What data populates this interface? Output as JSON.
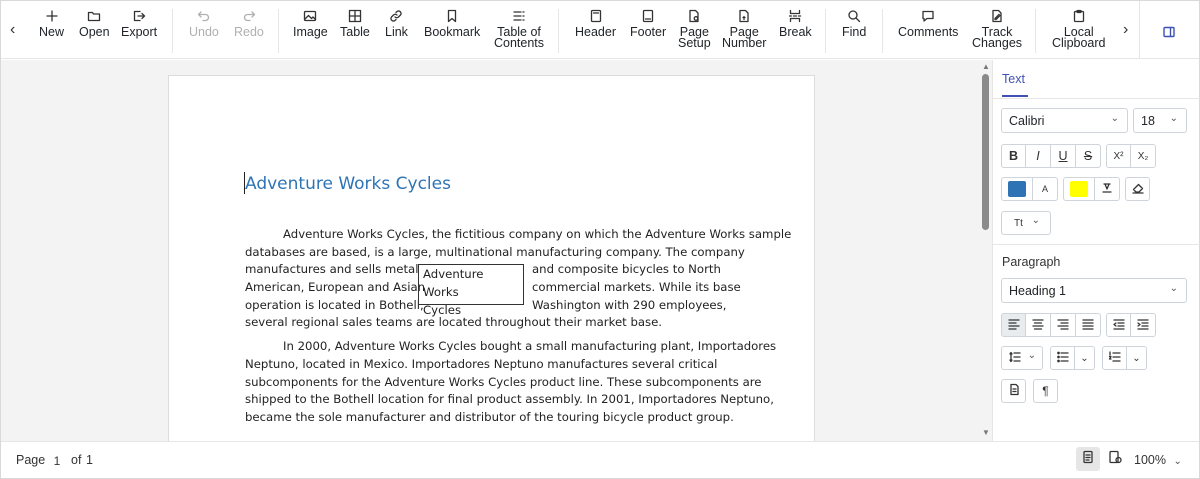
{
  "toolbar": {
    "nav_prev": "‹",
    "nav_next": "›",
    "items": [
      {
        "key": "new",
        "label": "New",
        "icon": "plus-icon"
      },
      {
        "key": "open",
        "label": "Open",
        "icon": "folder-icon"
      },
      {
        "key": "export",
        "label": "Export",
        "icon": "export-icon"
      },
      {
        "key": "undo",
        "label": "Undo",
        "icon": "undo-icon",
        "disabled": true
      },
      {
        "key": "redo",
        "label": "Redo",
        "icon": "redo-icon",
        "disabled": true
      },
      {
        "key": "image",
        "label": "Image",
        "icon": "image-icon"
      },
      {
        "key": "table",
        "label": "Table",
        "icon": "table-icon"
      },
      {
        "key": "link",
        "label": "Link",
        "icon": "link-icon"
      },
      {
        "key": "bookmark",
        "label": "Bookmark",
        "icon": "bookmark-icon"
      },
      {
        "key": "toc",
        "label": "Table of\nContents",
        "icon": "toc-icon"
      },
      {
        "key": "header",
        "label": "Header",
        "icon": "header-icon"
      },
      {
        "key": "footer",
        "label": "Footer",
        "icon": "footer-icon"
      },
      {
        "key": "page_setup",
        "label": "Page\nSetup",
        "icon": "page-setup-icon"
      },
      {
        "key": "page_number",
        "label": "Page\nNumber",
        "icon": "page-number-icon"
      },
      {
        "key": "break",
        "label": "Break",
        "icon": "break-icon"
      },
      {
        "key": "find",
        "label": "Find",
        "icon": "search-icon"
      },
      {
        "key": "comments",
        "label": "Comments",
        "icon": "comment-icon"
      },
      {
        "key": "track_changes",
        "label": "Track\nChanges",
        "icon": "track-changes-icon"
      },
      {
        "key": "local_clipboard",
        "label": "Local\nClipboard",
        "icon": "clipboard-icon"
      }
    ],
    "panel_toggle_icon": "panel-toggle-icon"
  },
  "document": {
    "title": "Adventure Works Cycles",
    "para1_lines": [
      "Adventure Works Cycles, the fictitious company on which the Adventure Works sample",
      "databases are based, is a large, multinational manufacturing company. The company"
    ],
    "wrap_left_lines": [
      "manufactures and sells metal",
      "American, European and Asian",
      "operation is located in Bothell,"
    ],
    "wrap_right_lines": [
      "and composite bicycles to North",
      "commercial markets. While its base",
      "Washington with 290 employees,"
    ],
    "para1_last_line": "several regional sales teams are located throughout their market base.",
    "textbox_lines": [
      "Adventure Works",
      "Cycles"
    ],
    "para2_lines": [
      "In 2000, Adventure Works Cycles bought a small manufacturing plant, Importadores",
      "Neptuno, located in Mexico. Importadores Neptuno manufactures several critical",
      "subcomponents for the Adventure Works Cycles product line. These subcomponents are",
      "shipped to the Bothell location for final product assembly. In 2001, Importadores Neptuno,",
      "became the sole manufacturer and distributor of the touring bicycle product group."
    ],
    "title_color": "#2e74b5"
  },
  "panel": {
    "tab_text": "Text",
    "font_family": "Calibri",
    "font_size": "18",
    "format_buttons": [
      "B",
      "I",
      "U",
      "S",
      "X²",
      "X₂"
    ],
    "font_color": "#2e74b5",
    "highlight_color": "#ffff00",
    "case_button": "Tt",
    "paragraph_title": "Paragraph",
    "style": "Heading 1",
    "accent_color": "#3f51b5"
  },
  "status": {
    "page_label": "Page",
    "page_current": "1",
    "of_label": "of",
    "page_total": "1",
    "zoom": "100%"
  }
}
